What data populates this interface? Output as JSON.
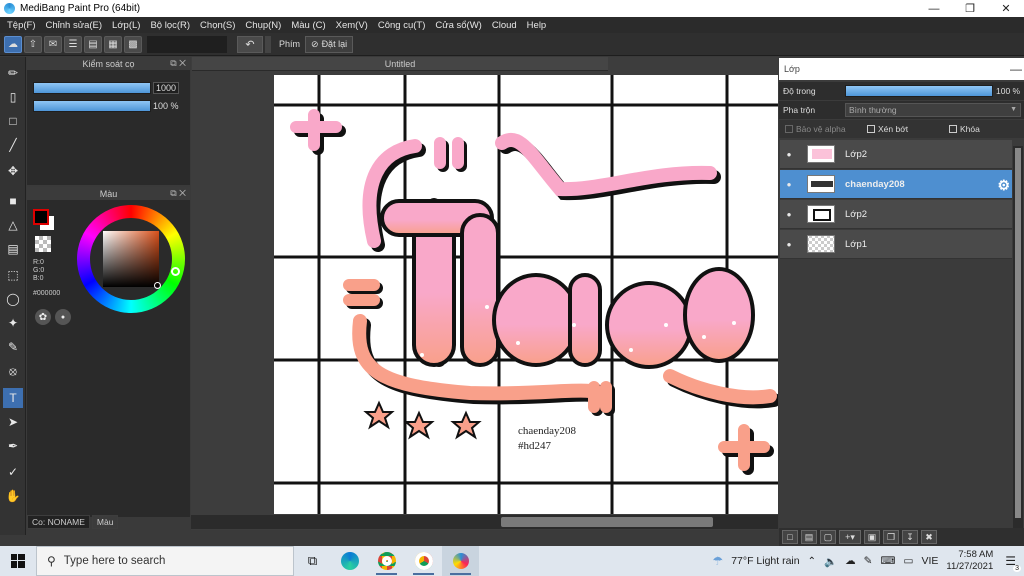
{
  "window": {
    "title": "MediBang Paint Pro (64bit)",
    "minimize_icon": "minimize-icon",
    "maximize_icon": "restore-icon",
    "close_icon": "close-icon"
  },
  "menu": [
    "Tệp(F)",
    "Chỉnh sửa(E)",
    "Lớp(L)",
    "Bộ lọc(R)",
    "Chọn(S)",
    "Chụp(N)",
    "Màu (C)",
    "Xem(V)",
    "Công cụ(T)",
    "Cửa sổ(W)",
    "Cloud",
    "Help"
  ],
  "toolbar": {
    "shortcut_label": "Phím",
    "reset_label": "Đặt lại"
  },
  "brush_panel": {
    "title": "Kiểm soát cọ",
    "size_value": "1000",
    "opacity_value": "100 %"
  },
  "color_panel": {
    "title": "Màu",
    "r_label": "R:0",
    "g_label": "G:0",
    "b_label": "B:0",
    "hex": "#000000",
    "primary_color": "#000000",
    "secondary_color": "#ffffff"
  },
  "bottom_tabs": {
    "brush_tab": "Co: NONAME",
    "color_tab": "Màu"
  },
  "document": {
    "tab_title": "Untitled",
    "signature_line1": "chaenday208",
    "signature_line2": "#hd247"
  },
  "layers_panel": {
    "title": "Lớp",
    "opacity_label": "Độ trong",
    "opacity_value": "100 %",
    "opacity_level": 1.0,
    "blend_label": "Pha trộn",
    "blend_value": "Bình thường",
    "protect_alpha": "Bảo vệ alpha",
    "clipping": "Xén bớt",
    "lock": "Khóa",
    "layers": [
      {
        "name": "Lớp2",
        "selected": false
      },
      {
        "name": "chaenday208",
        "selected": true
      },
      {
        "name": "Lớp2",
        "selected": false
      },
      {
        "name": "Lớp1",
        "selected": false
      }
    ]
  },
  "taskbar": {
    "search_placeholder": "Type here to search",
    "weather": "77°F  Light rain",
    "lang": "VIE",
    "time": "7:58 AM",
    "date": "11/27/2021",
    "notifications": "3"
  },
  "accent_color": "#4e8fd0",
  "art_colors": {
    "pink": "#f9a8c9",
    "peach": "#f9a08a",
    "outline": "#111111"
  }
}
